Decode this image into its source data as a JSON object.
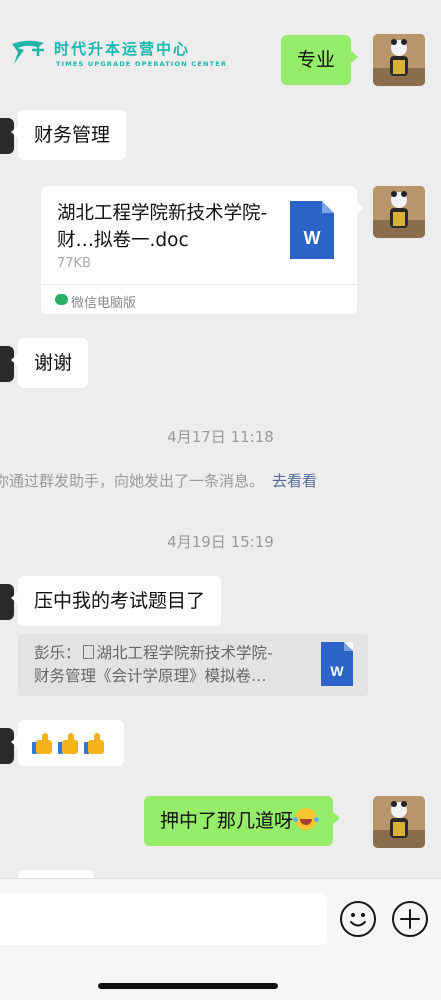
{
  "watermark": {
    "name_cn": "时代升本运营中心",
    "name_en": "TIMES UPGRADE OPERATION CENTER"
  },
  "colors": {
    "background": "#ededed",
    "sent_bubble": "#95ec69",
    "received_bubble": "#ffffff",
    "link": "#576b95",
    "word_blue": "#2b63c6"
  },
  "messages": {
    "m1_sent": "专业",
    "m2_received": "财务管理",
    "m3_file": {
      "name": "湖北工程学院新技术学院-财…拟卷一.doc",
      "size": "77KB",
      "source": "微信电脑版",
      "icon_letter": "W"
    },
    "m4_received": "谢谢",
    "ts1": "4月17日 11:18",
    "sys1": {
      "text": "你通过群发助手，向她发出了一条消息。",
      "link": "去看看"
    },
    "ts2": "4月19日 15:19",
    "m5_received": "压中我的考试题目了",
    "m5_quote": {
      "sender": "彭乐：",
      "line1": "湖北工程学院新技术学院-",
      "line2": "财务管理《会计学原理》模拟卷…",
      "icon_letter": "W"
    },
    "m6_received_emoji": "thumbs-up x3",
    "m7_sent": "押中了那几道呀"
  },
  "input_bar": {
    "emoji_button_icon": "smile-icon",
    "plus_button_icon": "plus-icon"
  }
}
